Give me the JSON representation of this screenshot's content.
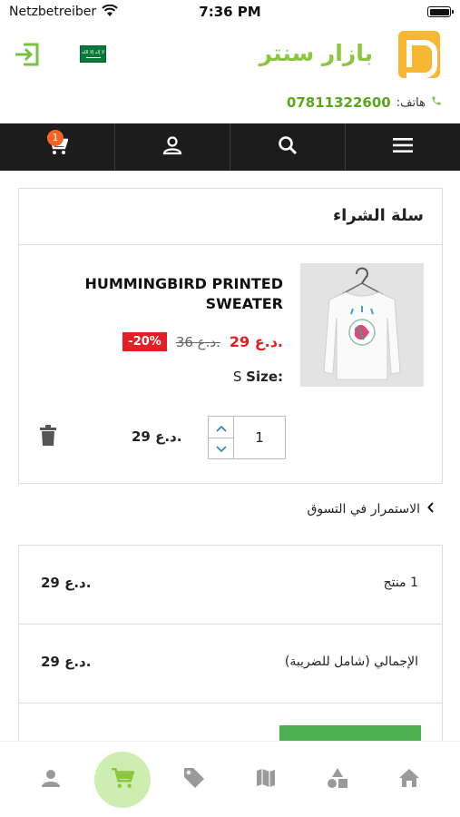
{
  "status_bar": {
    "carrier": "Netzbetreiber",
    "time": "7:36 PM"
  },
  "header": {
    "brand_name": "بازار سنتر",
    "phone_label": "هاتف:",
    "phone_number": "07811322600",
    "flag_text": "ﻻ إله إﻻ الله"
  },
  "navbar": {
    "items": [
      "menu-icon",
      "search-icon",
      "account-icon",
      "cart-icon"
    ],
    "cart_count": "1"
  },
  "cart": {
    "title": "سلة الشراء",
    "product": {
      "name": "HUMMINGBIRD PRINTED SWEATER",
      "new_price": "29 د.ع.",
      "old_price": "36 د.ع.",
      "discount": "-20%",
      "size_label": "Size:",
      "size_value": "S",
      "quantity": "1",
      "line_total": "29 د.ع."
    }
  },
  "continue_shopping": "الاستمرار في التسوق",
  "summary": {
    "rows": [
      {
        "label": "1 منتج",
        "value": "29 د.ع."
      },
      {
        "label": "الإجمالي (شامل للضريبة)",
        "value": "29 د.ع."
      }
    ]
  },
  "tabbar": {
    "items": [
      "profile-icon",
      "cart-icon",
      "tag-icon",
      "map-icon",
      "categories-icon",
      "home-icon"
    ],
    "active": "cart-icon"
  },
  "colors": {
    "brand_green": "#8cc63f",
    "logo_orange": "#f7b733",
    "price_red": "#e31e24",
    "navbar_bg": "#1c1c1c",
    "checkout_green": "#4caf50"
  }
}
